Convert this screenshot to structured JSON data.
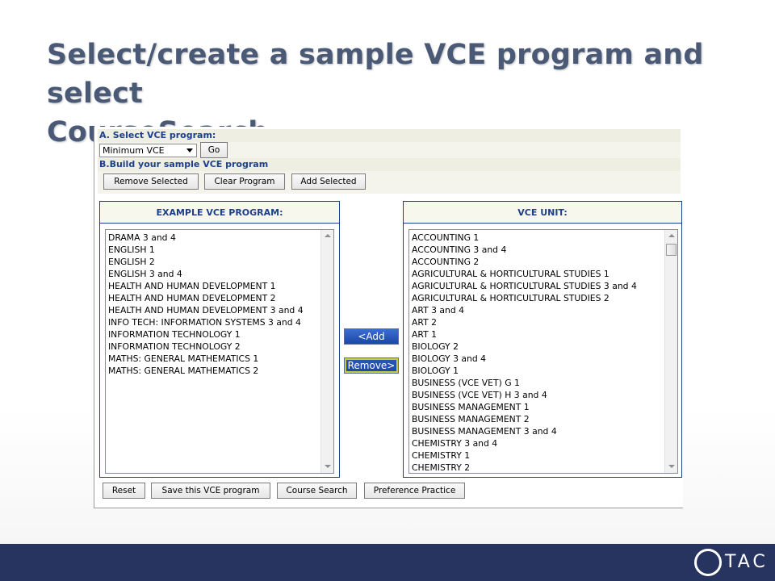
{
  "slide": {
    "title_line1": "Select/create a sample VCE program and select",
    "title_line2": "CourseSearch."
  },
  "section_a": {
    "heading": "A. Select VCE program:",
    "select_value": "Minimum VCE",
    "go_label": "Go"
  },
  "section_b": {
    "heading": "B.Build your sample VCE program",
    "remove_selected_label": "Remove Selected",
    "clear_program_label": "Clear Program",
    "add_selected_label": "Add Selected"
  },
  "left_panel": {
    "header": "EXAMPLE VCE PROGRAM:",
    "items": [
      "DRAMA 3 and 4",
      "ENGLISH 1",
      "ENGLISH 2",
      "ENGLISH 3 and 4",
      "HEALTH AND HUMAN DEVELOPMENT 1",
      "HEALTH AND HUMAN DEVELOPMENT 2",
      "HEALTH AND HUMAN DEVELOPMENT 3 and 4",
      "INFO TECH: INFORMATION SYSTEMS 3 and 4",
      "INFORMATION TECHNOLOGY 1",
      "INFORMATION TECHNOLOGY 2",
      "MATHS: GENERAL MATHEMATICS 1",
      "MATHS: GENERAL MATHEMATICS 2"
    ]
  },
  "right_panel": {
    "header": "VCE UNIT:",
    "items": [
      "ACCOUNTING 1",
      "ACCOUNTING 3 and 4",
      "ACCOUNTING 2",
      "AGRICULTURAL & HORTICULTURAL STUDIES 1",
      "AGRICULTURAL & HORTICULTURAL STUDIES 3 and 4",
      "AGRICULTURAL & HORTICULTURAL STUDIES 2",
      "ART 3 and 4",
      "ART 2",
      "ART 1",
      "BIOLOGY 2",
      "BIOLOGY 3 and 4",
      "BIOLOGY 1",
      "BUSINESS (VCE VET) G 1",
      "BUSINESS (VCE VET) H 3 and 4",
      "BUSINESS MANAGEMENT 1",
      "BUSINESS MANAGEMENT 2",
      "BUSINESS MANAGEMENT 3 and 4",
      "CHEMISTRY 3 and 4",
      "CHEMISTRY 1",
      "CHEMISTRY 2"
    ]
  },
  "transfer": {
    "add_label": "<Add",
    "remove_label": "Remove>"
  },
  "bottom_buttons": {
    "reset_label": "Reset",
    "save_label": "Save this VCE program",
    "course_search_label": "Course Search",
    "preference_practice_label": "Preference Practice"
  },
  "footer": {
    "logo_text": "TAC"
  },
  "colors": {
    "heading_blue": "#1e3f8a",
    "title_slate": "#4a5a76",
    "footer_navy": "#283460"
  }
}
